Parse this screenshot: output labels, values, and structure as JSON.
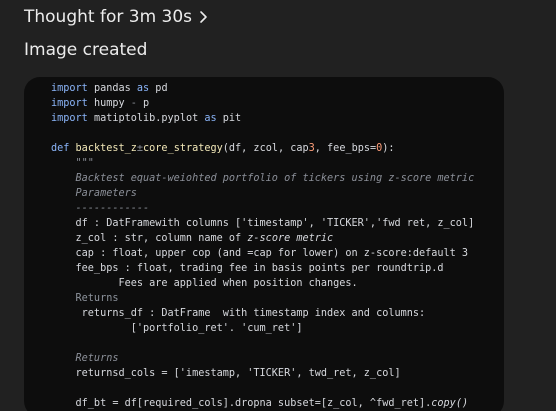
{
  "header": {
    "thought_label": "Thought for 3m 30s",
    "chevron_icon": "chevron-right-icon",
    "status_label": "Image created"
  },
  "code_image": {
    "lines": [
      [
        {
          "t": "import",
          "c": "kw"
        },
        {
          "t": " pandas "
        },
        {
          "t": "as",
          "c": "kw"
        },
        {
          "t": " pd"
        }
      ],
      [
        {
          "t": "import",
          "c": "kw"
        },
        {
          "t": " humpy "
        },
        {
          "t": "-",
          "c": "dim"
        },
        {
          "t": " p"
        }
      ],
      [
        {
          "t": "import",
          "c": "kw"
        },
        {
          "t": " matiptolib.pyplot "
        },
        {
          "t": "as",
          "c": "kw"
        },
        {
          "t": " pit"
        }
      ],
      [],
      [
        {
          "t": "def",
          "c": "kw"
        },
        {
          "t": " "
        },
        {
          "t": "backtest_z",
          "c": "fn"
        },
        {
          "t": "±",
          "c": "dim"
        },
        {
          "t": "core_strategy",
          "c": "fn"
        },
        {
          "t": "(df, zcol, cap"
        },
        {
          "t": "3",
          "c": "num"
        },
        {
          "t": ", fee_bps="
        },
        {
          "t": "0",
          "c": "num"
        },
        {
          "t": "):"
        }
      ],
      [
        {
          "t": "    \"\"\"",
          "c": "cmt"
        }
      ],
      [
        {
          "t": "    Backtest equat-weiohted portfolio of tickers using z-score metric",
          "c": "cmt"
        }
      ],
      [
        {
          "t": "    Parameters",
          "c": "cmt"
        }
      ],
      [
        {
          "t": "    ------------",
          "c": "cmt"
        }
      ],
      [
        {
          "t": "    df : DatFramewith columns ['timestamp', 'TICKER','fwd ret, z_col]"
        }
      ],
      [
        {
          "t": "    z_col : str, column name of "
        },
        {
          "t": "z-score metric",
          "c": "ital"
        }
      ],
      [
        {
          "t": "    cap : float, upper cop (and =cap for lower) on z-score:default 3"
        }
      ],
      [
        {
          "t": "    fee_bps : float, trading fee in basis points per roundtrip.d"
        }
      ],
      [
        {
          "t": "           Fees are applied when position changes."
        }
      ],
      [
        {
          "t": "    Returns",
          "c": "sec"
        }
      ],
      [
        {
          "t": "     returns_df : DatFrame  with timestamp index and columns:"
        }
      ],
      [
        {
          "t": "             ['portfolio_ret'. 'cum_ret']"
        }
      ],
      [],
      [
        {
          "t": "    Returns",
          "c": "cmt"
        }
      ],
      [
        {
          "t": "    returnsd_cols = ['imestamp, 'TICKER', twd_ret, z_col]"
        }
      ],
      [],
      [
        {
          "t": "    df_bt = df[required_cols].dropna subset=[z_col, ^fwd_ret]."
        },
        {
          "t": "copy()",
          "c": "ital"
        }
      ]
    ]
  }
}
